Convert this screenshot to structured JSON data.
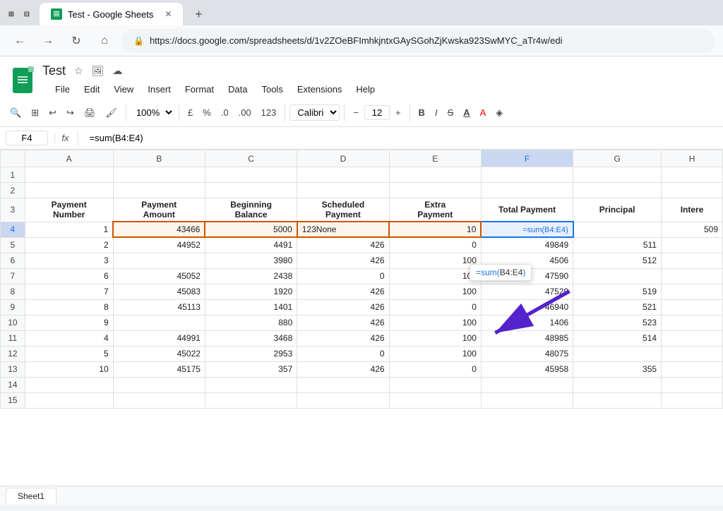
{
  "browser": {
    "tab_title": "Test - Google Sheets",
    "tab_new": "+",
    "url": "https://docs.google.com/spreadsheets/d/1v2ZOeBFImhkjntxGAySGohZjKwska923SwMYC_aTr4w/edi",
    "nav": {
      "back": "←",
      "forward": "→",
      "reload": "↻",
      "home": "⌂"
    }
  },
  "sheets": {
    "title": "Test",
    "menu": [
      "File",
      "Edit",
      "View",
      "Insert",
      "Format",
      "Data",
      "Tools",
      "Extensions",
      "Help"
    ],
    "toolbar": {
      "zoom": "100%",
      "currency": "£",
      "percent": "%",
      "decimal_dec": ".0",
      "decimal_inc": ".00",
      "format_123": "123",
      "font": "Calibri",
      "font_size": "12",
      "bold": "B",
      "italic": "I",
      "strikethrough": "S̶",
      "underline": "A"
    },
    "formula_bar": {
      "cell_ref": "F4",
      "fx": "fx",
      "formula": "=sum(B4:E4)"
    },
    "columns": [
      "",
      "A",
      "B",
      "C",
      "D",
      "E",
      "F",
      "G",
      "H"
    ],
    "rows": [
      {
        "num": "1",
        "cells": [
          "",
          "",
          "",
          "",
          "",
          "",
          "",
          "",
          ""
        ]
      },
      {
        "num": "2",
        "cells": [
          "",
          "",
          "",
          "",
          "",
          "",
          "",
          "",
          ""
        ]
      },
      {
        "num": "3",
        "cells": [
          "",
          "Payment\nNumber",
          "Payment\nAmount",
          "Beginning\nBalance",
          "Scheduled\nPayment",
          "Extra\nPayment",
          "Total Payment",
          "Principal",
          "Intere"
        ]
      },
      {
        "num": "4",
        "cells": [
          "",
          "1",
          "43466",
          "5000",
          "123None",
          "10",
          "=sum(B4:E4)",
          "",
          "509"
        ]
      },
      {
        "num": "5",
        "cells": [
          "",
          "2",
          "44952",
          "4491",
          "426",
          "0",
          "49849",
          "511",
          ""
        ]
      },
      {
        "num": "6",
        "cells": [
          "",
          "3",
          "",
          "3980",
          "426",
          "100",
          "4506",
          "512",
          ""
        ]
      },
      {
        "num": "7",
        "cells": [
          "",
          "6",
          "45052",
          "2438",
          "0",
          "100",
          "47590",
          "",
          ""
        ]
      },
      {
        "num": "8",
        "cells": [
          "",
          "7",
          "45083",
          "1920",
          "426",
          "100",
          "47529",
          "519",
          ""
        ]
      },
      {
        "num": "9",
        "cells": [
          "",
          "8",
          "45113",
          "1401",
          "426",
          "0",
          "46940",
          "521",
          ""
        ]
      },
      {
        "num": "10",
        "cells": [
          "",
          "9",
          "",
          "880",
          "426",
          "100",
          "1406",
          "523",
          ""
        ]
      },
      {
        "num": "11",
        "cells": [
          "",
          "4",
          "44991",
          "3468",
          "426",
          "100",
          "48985",
          "514",
          ""
        ]
      },
      {
        "num": "12",
        "cells": [
          "",
          "5",
          "45022",
          "2953",
          "0",
          "100",
          "48075",
          "",
          ""
        ]
      },
      {
        "num": "13",
        "cells": [
          "",
          "10",
          "45175",
          "357",
          "426",
          "0",
          "45958",
          "355",
          ""
        ]
      },
      {
        "num": "14",
        "cells": [
          "",
          "",
          "",
          "",
          "",
          "",
          "",
          "",
          ""
        ]
      },
      {
        "num": "15",
        "cells": [
          "",
          "",
          "",
          "",
          "",
          "",
          "",
          "",
          ""
        ]
      }
    ],
    "autocomplete": {
      "text": "=sum(B4:E4)"
    },
    "sheet_tab": "Sheet1"
  }
}
